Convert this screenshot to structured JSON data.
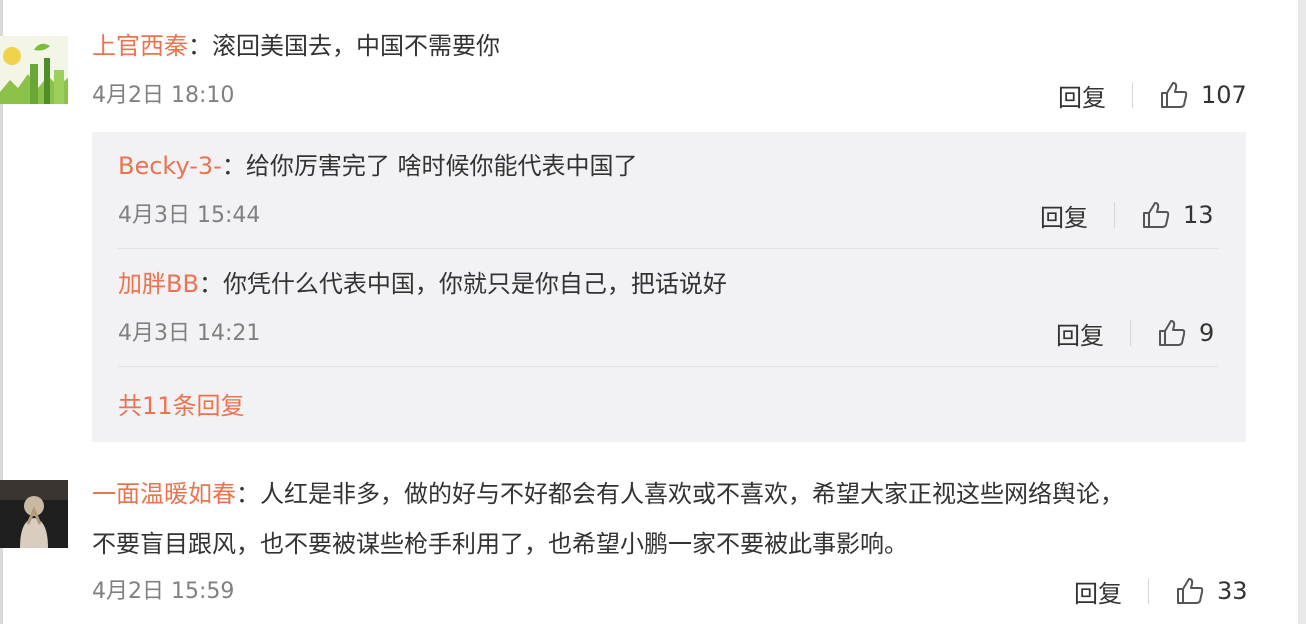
{
  "comments": [
    {
      "user": "上官西秦",
      "colon": "：",
      "text": "滚回美国去，中国不需要你",
      "time": "4月2日 18:10",
      "reply_label": "回复",
      "likes": "107",
      "avatar_icon": "landscape-avatar-icon"
    },
    {
      "user": "一面温暖如春",
      "colon": "：",
      "text_line1": "人红是非多，做的好与不好都会有人喜欢或不喜欢，希望大家正视这些网络舆论，",
      "text_line2": "不要盲目跟风，也不要被谋些枪手利用了，也希望小鹏一家不要被此事影响。",
      "time": "4月2日 15:59",
      "reply_label": "回复",
      "likes": "33",
      "avatar_icon": "person-avatar-icon"
    }
  ],
  "replies": [
    {
      "user": "Becky-3-",
      "colon": "：",
      "text": "给你厉害完了 啥时候你能代表中国了",
      "time": "4月3日 15:44",
      "reply_label": "回复",
      "likes": "13"
    },
    {
      "user": "加胖BB",
      "colon": "：",
      "text": "你凭什么代表中国，你就只是你自己，把话说好",
      "time": "4月3日 14:21",
      "reply_label": "回复",
      "likes": "9"
    }
  ],
  "more_replies_label": "共11条回复",
  "colors": {
    "username": "#eb7350",
    "text": "#333333",
    "meta": "#808080",
    "reply_bg": "#f2f2f5"
  },
  "icons": {
    "like": "thumbs-up-icon"
  }
}
